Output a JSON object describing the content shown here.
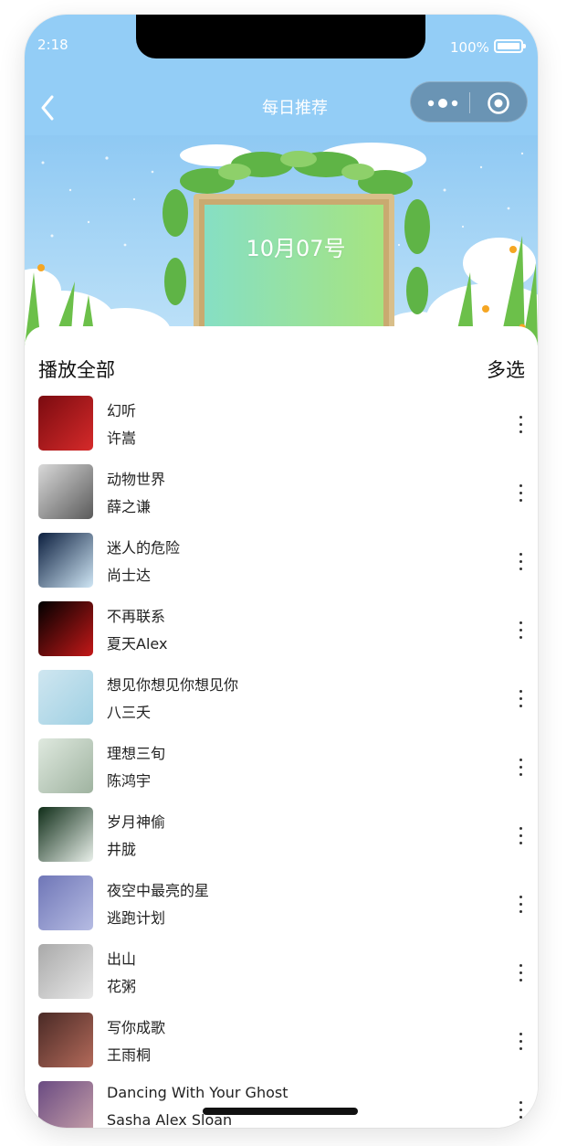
{
  "status_bar": {
    "time": "2:18",
    "battery": "100%"
  },
  "nav": {
    "title": "每日推荐"
  },
  "banner": {
    "date": "10月07号"
  },
  "actions": {
    "play_all": "播放全部",
    "multi_select": "多选"
  },
  "songs": [
    {
      "title": "幻听",
      "artist": "许嵩",
      "cover_colors": [
        "#7a0b10",
        "#d62a2a"
      ]
    },
    {
      "title": "动物世界",
      "artist": "薛之谦",
      "cover_colors": [
        "#d9d9d9",
        "#5a5a5a"
      ]
    },
    {
      "title": "迷人的危险",
      "artist": "尚士达",
      "cover_colors": [
        "#0c1f3f",
        "#cfe6f5"
      ]
    },
    {
      "title": "不再联系",
      "artist": "夏天Alex",
      "cover_colors": [
        "#000000",
        "#c41818"
      ]
    },
    {
      "title": "想见你想见你想见你",
      "artist": "八三夭",
      "cover_colors": [
        "#cfe6f0",
        "#9fd0e3"
      ]
    },
    {
      "title": "理想三旬",
      "artist": "陈鸿宇",
      "cover_colors": [
        "#dfe9df",
        "#9fb3a0"
      ]
    },
    {
      "title": "岁月神偷",
      "artist": "井胧",
      "cover_colors": [
        "#0f2d18",
        "#e9f0ea"
      ]
    },
    {
      "title": "夜空中最亮的星",
      "artist": "逃跑计划",
      "cover_colors": [
        "#6f76b7",
        "#b6bce3"
      ]
    },
    {
      "title": "出山",
      "artist": "花粥",
      "cover_colors": [
        "#a9a9a9",
        "#e8e8e8"
      ]
    },
    {
      "title": "写你成歌",
      "artist": "王雨桐",
      "cover_colors": [
        "#4a2a26",
        "#b36a5a"
      ]
    },
    {
      "title": "Dancing With Your Ghost",
      "artist": "Sasha Alex Sloan",
      "cover_colors": [
        "#6a4b82",
        "#c8a1a9"
      ]
    }
  ]
}
